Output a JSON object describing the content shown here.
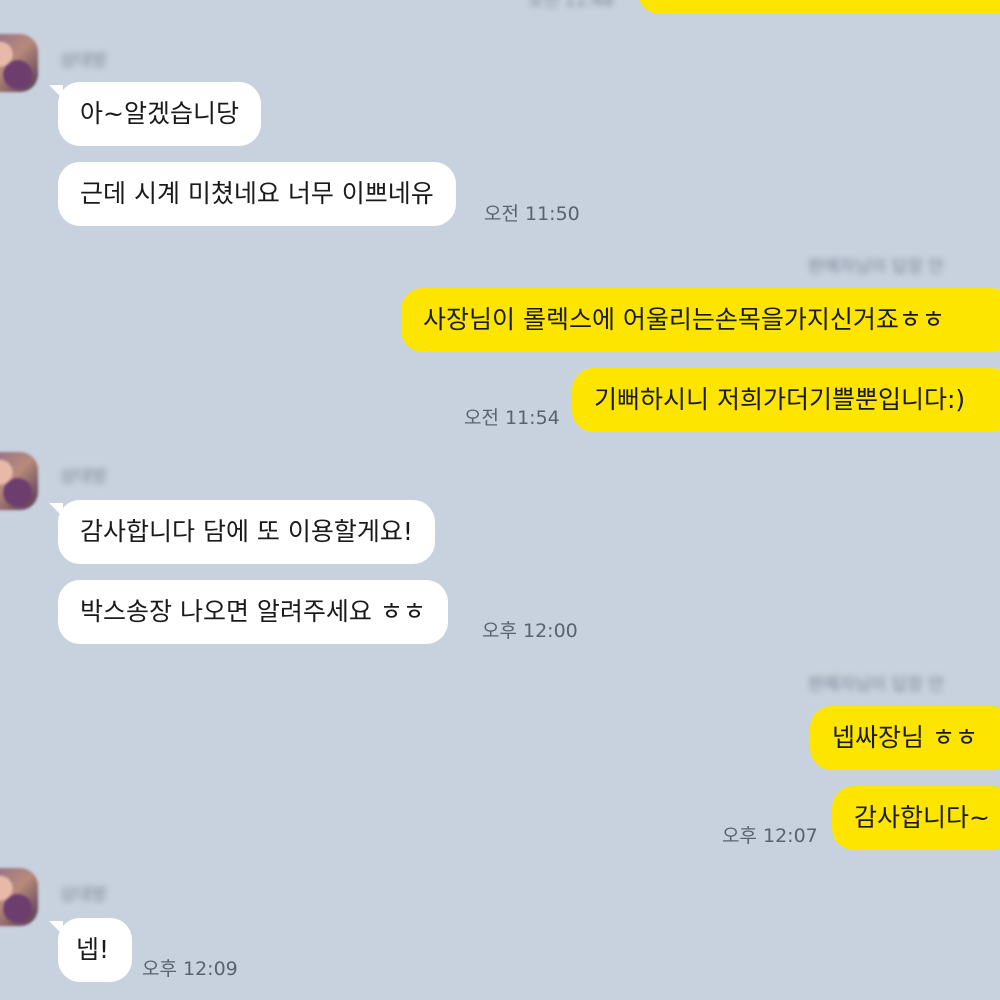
{
  "messages": [
    {
      "text": "아~알겠습니당"
    },
    {
      "text": "근데 시계 미쳤네요 너무 이쁘네유",
      "time": "오전 11:50"
    },
    {
      "text": "사장님이 롤렉스에 어울리는손목을가지신거죠ㅎㅎ"
    },
    {
      "text": "기뻐하시니 저희가더기쁠뿐입니다:)",
      "time": "오전 11:54"
    },
    {
      "text": "감사합니다 담에 또 이용할게요!"
    },
    {
      "text": "박스송장 나오면 알려주세요 ㅎㅎ",
      "time": "오후 12:00"
    },
    {
      "text": "넵싸장님 ㅎㅎ"
    },
    {
      "text": "감사합니다~",
      "time": "오후 12:07"
    },
    {
      "text": "넵!",
      "time": "오후 12:09"
    }
  ],
  "colors": {
    "background": "#c8d1de",
    "incoming_bubble": "#ffffff",
    "outgoing_bubble": "#fde500",
    "timestamp": "#5a6270"
  },
  "icons": [
    "avatar"
  ]
}
